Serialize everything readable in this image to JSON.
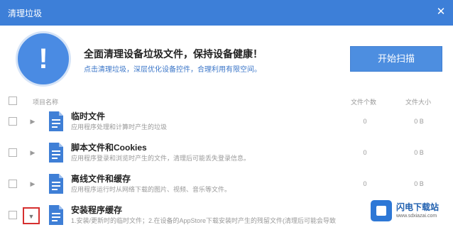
{
  "window": {
    "title": "清理垃圾",
    "close_symbol": "✕"
  },
  "banner": {
    "icon_symbol": "!",
    "headline": "全面清理设备垃圾文件，保持设备健康！",
    "subline": "点击清理垃圾，深层优化设备控件，合理利用有限空间。",
    "scan_button": "开始扫描"
  },
  "table": {
    "headers": {
      "name": "项目名称",
      "count": "文件个数",
      "size": "文件大小"
    },
    "rows": [
      {
        "title": "临时文件",
        "desc": "应用程序处理和计算时产生的垃圾",
        "count": "0",
        "size": "0 B",
        "expander_symbol": "▶"
      },
      {
        "title": "脚本文件和Cookies",
        "desc": "应用程序登录和浏览时产生的文件，清理后可能丢失登录信息。",
        "count": "0",
        "size": "0 B",
        "expander_symbol": "▶"
      },
      {
        "title": "离线文件和缓存",
        "desc": "应用程序运行时从网络下载的图片、视频、音乐等文件。",
        "count": "0",
        "size": "0 B",
        "expander_symbol": "▶"
      },
      {
        "title": "安装程序缓存",
        "desc": "1.安装/更新时的临时文件；2.在设备的AppStore下载安装时产生的残留文件(清理后可能会导致",
        "count": "",
        "size": "",
        "expander_symbol": "▼"
      }
    ]
  },
  "watermark": {
    "name": "闪电下载站",
    "url": "www.sdxiazai.com"
  },
  "colors": {
    "titlebar": "#3d7fd8",
    "accent": "#4d8ee0",
    "highlight_border": "#d63030"
  },
  "icons": {
    "alert": "exclamation-circle-icon",
    "document": "document-icon",
    "expand": "caret-right-icon",
    "collapse": "caret-down-icon"
  }
}
